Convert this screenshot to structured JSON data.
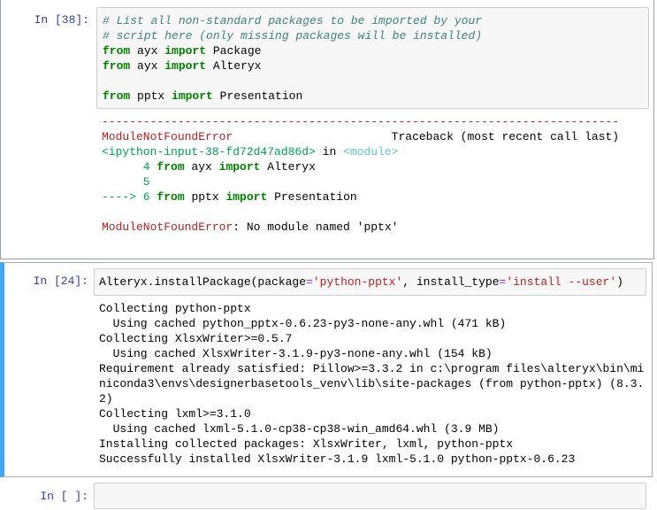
{
  "cells": [
    {
      "prompt": "In [38]:",
      "input": [
        [
          [
            "# List all non-standard packages to be imported by your",
            "cm"
          ]
        ],
        [
          [
            "# script here (only missing packages will be installed)",
            "cm"
          ]
        ],
        [
          [
            "from",
            "kw"
          ],
          [
            " ayx ",
            "nm"
          ],
          [
            "import",
            "kw"
          ],
          [
            " Package",
            "nm"
          ]
        ],
        [
          [
            "from",
            "kw"
          ],
          [
            " ayx ",
            "nm"
          ],
          [
            "import",
            "kw"
          ],
          [
            " Alteryx",
            "nm"
          ]
        ],
        [
          [
            "",
            "nm"
          ]
        ],
        [
          [
            "from",
            "kw"
          ],
          [
            " pptx ",
            "nm"
          ],
          [
            "import",
            "kw"
          ],
          [
            " Presentation",
            "nm"
          ]
        ]
      ],
      "output": [
        [
          [
            "---------------------------------------------------------------------------",
            "er"
          ]
        ],
        [
          [
            "ModuleNotFoundError",
            "er"
          ],
          [
            "                       Traceback (most recent call last)",
            "nm"
          ]
        ],
        [
          [
            "<ipython-input-38-fd72d47ad86d>",
            "gr"
          ],
          [
            " in ",
            "nm"
          ],
          [
            "<module>",
            "cy"
          ]
        ],
        [
          [
            "      4 ",
            "gr"
          ],
          [
            "from",
            "kw"
          ],
          [
            " ayx ",
            "nm"
          ],
          [
            "import",
            "kw"
          ],
          [
            " Alteryx",
            "nm"
          ]
        ],
        [
          [
            "      5",
            "gr"
          ]
        ],
        [
          [
            "----> 6 ",
            "gr"
          ],
          [
            "from",
            "kw"
          ],
          [
            " pptx ",
            "nm"
          ],
          [
            "import",
            "kw"
          ],
          [
            " Presentation",
            "nm"
          ]
        ],
        [
          [
            "",
            "nm"
          ]
        ],
        [
          [
            "ModuleNotFoundError",
            "er"
          ],
          [
            ": No module named 'pptx'",
            "nm"
          ]
        ]
      ]
    },
    {
      "prompt": "In [24]:",
      "input": [
        [
          [
            "Alteryx.installPackage(package",
            "nm"
          ],
          [
            "=",
            "op"
          ],
          [
            "'python-pptx'",
            "st"
          ],
          [
            ", install_type",
            "nm"
          ],
          [
            "=",
            "op"
          ],
          [
            "'install --user'",
            "st"
          ],
          [
            ")",
            "nm"
          ]
        ]
      ],
      "output": [
        [
          [
            "Collecting python-pptx",
            "nm"
          ]
        ],
        [
          [
            "  Using cached python_pptx-0.6.23-py3-none-any.whl (471 kB)",
            "nm"
          ]
        ],
        [
          [
            "Collecting XlsxWriter>=0.5.7",
            "nm"
          ]
        ],
        [
          [
            "  Using cached XlsxWriter-3.1.9-py3-none-any.whl (154 kB)",
            "nm"
          ]
        ],
        [
          [
            "Requirement already satisfied: Pillow>=3.3.2 in c:\\program files\\alteryx\\bin\\mi",
            "nm"
          ]
        ],
        [
          [
            "niconda3\\envs\\designerbasetools_venv\\lib\\site-packages (from python-pptx) (8.3.",
            "nm"
          ]
        ],
        [
          [
            "2)",
            "nm"
          ]
        ],
        [
          [
            "Collecting lxml>=3.1.0",
            "nm"
          ]
        ],
        [
          [
            "  Using cached lxml-5.1.0-cp38-cp38-win_amd64.whl (3.9 MB)",
            "nm"
          ]
        ],
        [
          [
            "Installing collected packages: XlsxWriter, lxml, python-pptx",
            "nm"
          ]
        ],
        [
          [
            "Successfully installed XlsxWriter-3.1.9 lxml-5.1.0 python-pptx-0.6.23",
            "nm"
          ]
        ]
      ]
    },
    {
      "prompt": "In [ ]:",
      "input": [],
      "output": []
    }
  ],
  "colors": {
    "prompt": "#303f9f",
    "keyword": "#008000",
    "comment": "#408080",
    "string": "#ba2121",
    "error": "#b22222",
    "selected_bar": "#42a5f5"
  }
}
